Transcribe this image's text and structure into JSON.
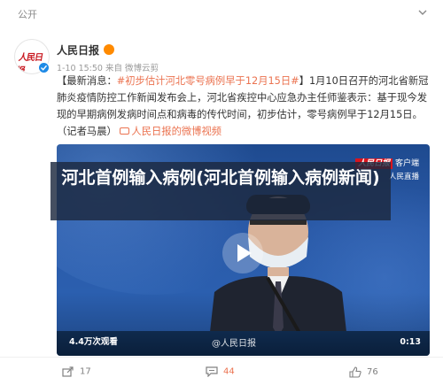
{
  "top_label": "公开",
  "author": {
    "name": "人民日报",
    "avatar_text": "人民日报",
    "meta": "1-10 15:50  来自 微博云剪"
  },
  "post": {
    "prefix": "【最新消息：",
    "hashtag": "#初步估计河北零号病例早于12月15日#",
    "body": "】1月10日召开的河北省新冠肺炎疫情防控工作新闻发布会上，河北省疾控中心应急办主任师鉴表示：基于现今发现的早期病例发病时间点和病毒的传代时间，初步估计，零号病例早于12月15日。（记者马晨）",
    "link_text": "人民日报的微博视频"
  },
  "video": {
    "overlay_title": "河北首例输入病例(河北首例输入病例新闻)",
    "views": "4.4万次观看",
    "duration": "0:13",
    "watermark": "@人民日报",
    "logo_brand": "人民日报",
    "logo_live": "客户端",
    "live_label": "人民直播"
  },
  "footer": {
    "share_count": "17",
    "comment_count": "44",
    "like_count": "76"
  },
  "colors": {
    "accent": "#eb7350",
    "verify": "#1e8ae6"
  }
}
